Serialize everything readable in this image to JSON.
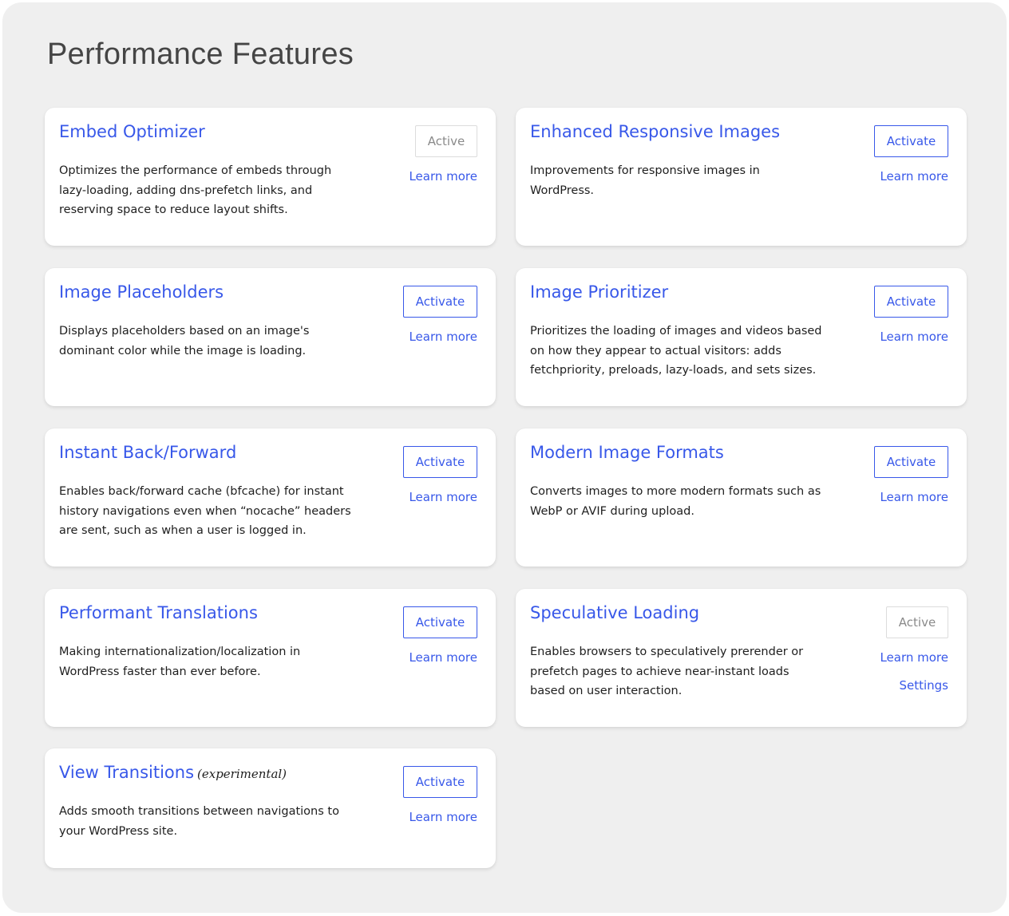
{
  "page": {
    "title": "Performance Features"
  },
  "colors": {
    "accent": "#3858e9",
    "panel_bg": "#efefef",
    "card_bg": "#ffffff",
    "muted": "#8a8a8a"
  },
  "features": [
    {
      "title": "Embed Optimizer",
      "suffix": "",
      "description": "Optimizes the performance of embeds through lazy-loading, adding dns-prefetch links, and reserving space to reduce layout shifts.",
      "status": "Active",
      "learn_more": "Learn more"
    },
    {
      "title": "Enhanced Responsive Images",
      "suffix": "",
      "description": "Improvements for responsive images in WordPress.",
      "status": "Activate",
      "learn_more": "Learn more"
    },
    {
      "title": "Image Placeholders",
      "suffix": "",
      "description": "Displays placeholders based on an image's dominant color while the image is loading.",
      "status": "Activate",
      "learn_more": "Learn more"
    },
    {
      "title": "Image Prioritizer",
      "suffix": "",
      "description": "Prioritizes the loading of images and videos based on how they appear to actual visitors: adds fetchpriority, preloads, lazy-loads, and sets sizes.",
      "status": "Activate",
      "learn_more": "Learn more"
    },
    {
      "title": "Instant Back/Forward",
      "suffix": "",
      "description": "Enables back/forward cache (bfcache) for instant history navigations even when “nocache” headers are sent, such as when a user is logged in.",
      "status": "Activate",
      "learn_more": "Learn more"
    },
    {
      "title": "Modern Image Formats",
      "suffix": "",
      "description": "Converts images to more modern formats such as WebP or AVIF during upload.",
      "status": "Activate",
      "learn_more": "Learn more"
    },
    {
      "title": "Performant Translations",
      "suffix": "",
      "description": "Making internationalization/localization in WordPress faster than ever before.",
      "status": "Activate",
      "learn_more": "Learn more"
    },
    {
      "title": "Speculative Loading",
      "suffix": "",
      "description": "Enables browsers to speculatively prerender or prefetch pages to achieve near-instant loads based on user interaction.",
      "status": "Active",
      "learn_more": "Learn more",
      "settings": "Settings"
    },
    {
      "title": "View Transitions",
      "suffix": "(experimental)",
      "description": "Adds smooth transitions between navigations to your WordPress site.",
      "status": "Activate",
      "learn_more": "Learn more"
    }
  ]
}
